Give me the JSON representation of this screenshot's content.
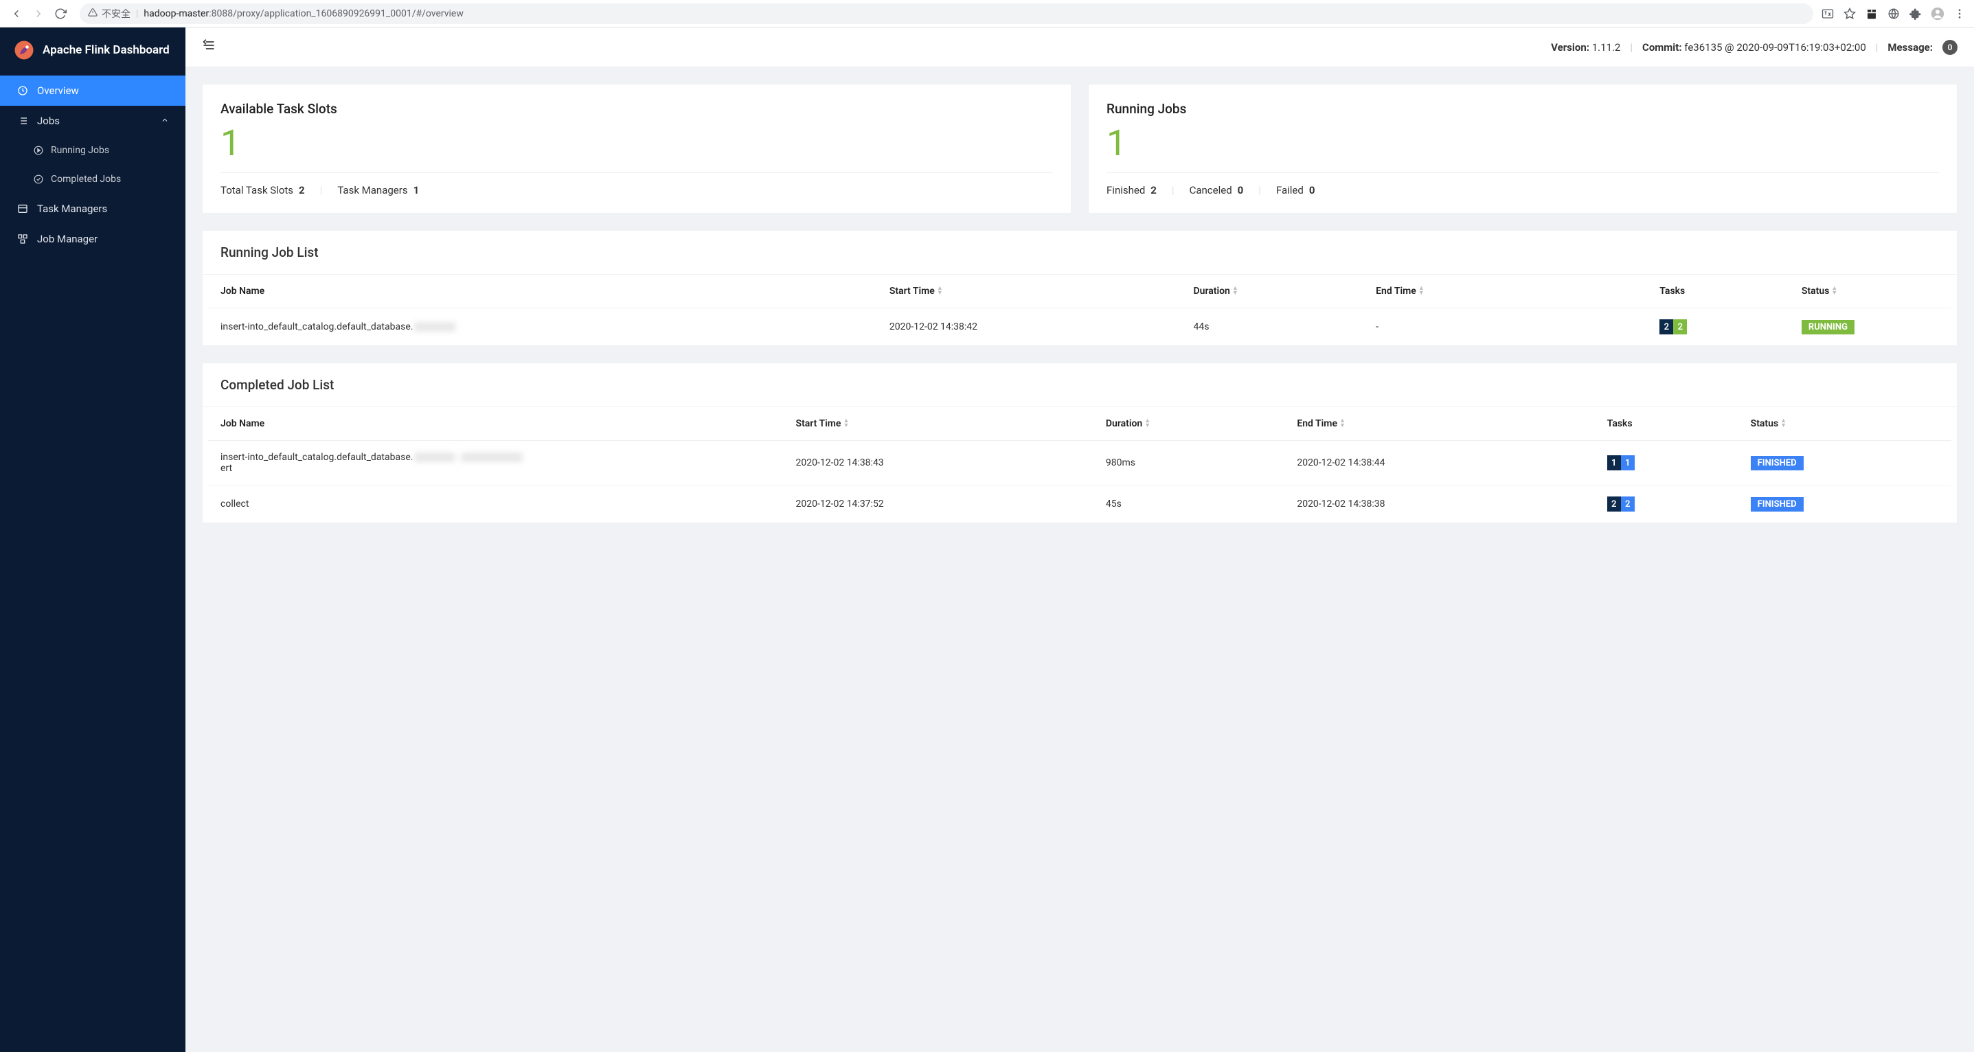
{
  "browser": {
    "not_secure_label": "不安全",
    "url_host": "hadoop-master",
    "url_rest": ":8088/proxy/application_1606890926991_0001/#/overview"
  },
  "sidebar": {
    "app_title": "Apache Flink Dashboard",
    "items": {
      "overview": "Overview",
      "jobs": "Jobs",
      "running_jobs": "Running Jobs",
      "completed_jobs": "Completed Jobs",
      "task_managers": "Task Managers",
      "job_manager": "Job Manager"
    }
  },
  "topbar": {
    "version_label": "Version:",
    "version_value": "1.11.2",
    "commit_label": "Commit:",
    "commit_value": "fe36135 @ 2020-09-09T16:19:03+02:00",
    "message_label": "Message:",
    "message_count": "0"
  },
  "cards": {
    "slots": {
      "title": "Available Task Slots",
      "value": "1",
      "total_slots_label": "Total Task Slots",
      "total_slots_value": "2",
      "tm_label": "Task Managers",
      "tm_value": "1"
    },
    "running": {
      "title": "Running Jobs",
      "value": "1",
      "finished_label": "Finished",
      "finished_value": "2",
      "canceled_label": "Canceled",
      "canceled_value": "0",
      "failed_label": "Failed",
      "failed_value": "0"
    }
  },
  "running_list": {
    "title": "Running Job List",
    "cols": {
      "name": "Job Name",
      "start": "Start Time",
      "duration": "Duration",
      "end": "End Time",
      "tasks": "Tasks",
      "status": "Status"
    },
    "rows": [
      {
        "name": "insert-into_default_catalog.default_database.",
        "start": "2020-12-02 14:38:42",
        "duration": "44s",
        "end": "-",
        "task_a": "2",
        "task_b": "2",
        "status": "RUNNING"
      }
    ]
  },
  "completed_list": {
    "title": "Completed Job List",
    "cols": {
      "name": "Job Name",
      "start": "Start Time",
      "duration": "Duration",
      "end": "End Time",
      "tasks": "Tasks",
      "status": "Status"
    },
    "rows": [
      {
        "name_pre": "insert-into_default_catalog.default_database.",
        "name_post": "ert",
        "start": "2020-12-02 14:38:43",
        "duration": "980ms",
        "end": "2020-12-02 14:38:44",
        "task_a": "1",
        "task_b": "1",
        "status": "FINISHED"
      },
      {
        "name_pre": "collect",
        "name_post": "",
        "start": "2020-12-02 14:37:52",
        "duration": "45s",
        "end": "2020-12-02 14:38:38",
        "task_a": "2",
        "task_b": "2",
        "status": "FINISHED"
      }
    ]
  }
}
